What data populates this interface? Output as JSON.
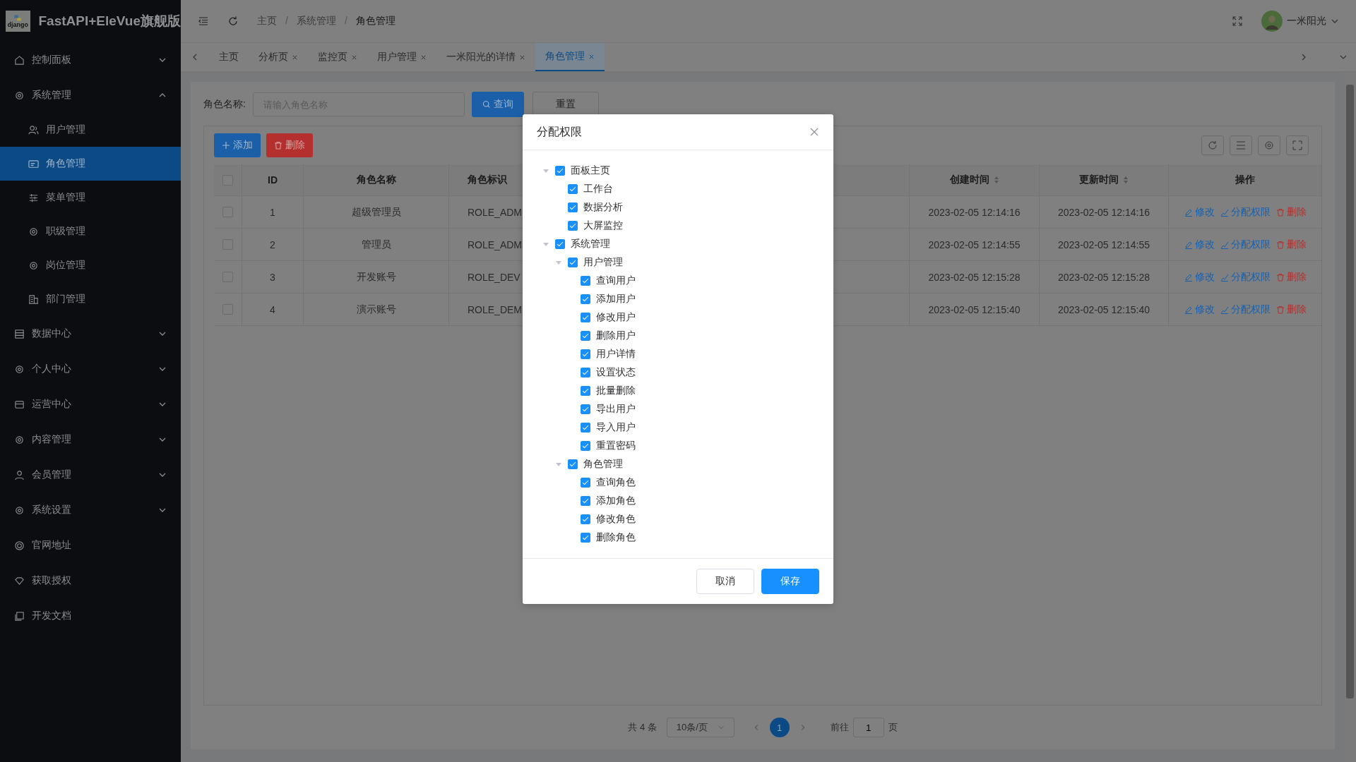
{
  "app": {
    "logo_text": "django",
    "title": "FastAPI+EleVue旗舰版"
  },
  "sidebar": {
    "items": [
      {
        "kind": "group",
        "label": "控制面板",
        "expanded": false,
        "selected": false
      },
      {
        "kind": "group",
        "label": "系统管理",
        "expanded": true,
        "selected": false,
        "children": [
          {
            "label": "用户管理",
            "selected": false
          },
          {
            "label": "角色管理",
            "selected": true
          },
          {
            "label": "菜单管理",
            "selected": false
          },
          {
            "label": "职级管理",
            "selected": false
          },
          {
            "label": "岗位管理",
            "selected": false
          },
          {
            "label": "部门管理",
            "selected": false
          }
        ]
      },
      {
        "kind": "group",
        "label": "数据中心",
        "expanded": false,
        "selected": false
      },
      {
        "kind": "group",
        "label": "个人中心",
        "expanded": false,
        "selected": false
      },
      {
        "kind": "group",
        "label": "运营中心",
        "expanded": false,
        "selected": false
      },
      {
        "kind": "group",
        "label": "内容管理",
        "expanded": false,
        "selected": false
      },
      {
        "kind": "group",
        "label": "会员管理",
        "expanded": false,
        "selected": false
      },
      {
        "kind": "group",
        "label": "系统设置",
        "expanded": false,
        "selected": false
      },
      {
        "kind": "link",
        "label": "官网地址",
        "selected": false
      },
      {
        "kind": "link",
        "label": "获取授权",
        "selected": false
      },
      {
        "kind": "link",
        "label": "开发文档",
        "selected": false
      }
    ]
  },
  "header": {
    "breadcrumb": [
      "主页",
      "系统管理",
      "角色管理"
    ],
    "breadcrumb_separator": "/",
    "user": "一米阳光"
  },
  "tabs": [
    {
      "label": "主页",
      "closable": false,
      "selected": false
    },
    {
      "label": "分析页",
      "closable": true,
      "selected": false
    },
    {
      "label": "监控页",
      "closable": true,
      "selected": false
    },
    {
      "label": "用户管理",
      "closable": true,
      "selected": false
    },
    {
      "label": "一米阳光的详情",
      "closable": true,
      "selected": false
    },
    {
      "label": "角色管理",
      "closable": true,
      "selected": true
    }
  ],
  "search": {
    "label": "角色名称:",
    "placeholder": "请输入角色名称",
    "query": "查询",
    "reset": "重置"
  },
  "toolbar": {
    "add": "添加",
    "delete": "删除"
  },
  "table": {
    "columns": [
      {
        "label": "ID",
        "sortable": false
      },
      {
        "label": "角色名称",
        "sortable": false
      },
      {
        "label": "角色标识",
        "sortable": false
      },
      {
        "label": "创建时间",
        "sortable": true
      },
      {
        "label": "更新时间",
        "sortable": true
      },
      {
        "label": "操作",
        "sortable": false
      }
    ],
    "all_checked": false,
    "rows": [
      {
        "checked": false,
        "id": "1",
        "name": "超级管理员",
        "code": "ROLE_ADM",
        "created": "2023-02-05 12:14:16",
        "updated": "2023-02-05 12:14:16",
        "actions": [
          "修改",
          "分配权限",
          "删除"
        ]
      },
      {
        "checked": false,
        "id": "2",
        "name": "管理员",
        "code": "ROLE_ADM",
        "created": "2023-02-05 12:14:55",
        "updated": "2023-02-05 12:14:55",
        "actions": [
          "修改",
          "分配权限",
          "删除"
        ]
      },
      {
        "checked": false,
        "id": "3",
        "name": "开发账号",
        "code": "ROLE_DEV",
        "created": "2023-02-05 12:15:28",
        "updated": "2023-02-05 12:15:28",
        "actions": [
          "修改",
          "分配权限",
          "删除"
        ]
      },
      {
        "checked": false,
        "id": "4",
        "name": "演示账号",
        "code": "ROLE_DEM",
        "created": "2023-02-05 12:15:40",
        "updated": "2023-02-05 12:15:40",
        "actions": [
          "修改",
          "分配权限",
          "删除"
        ]
      }
    ]
  },
  "pagination": {
    "total": "共 4 条",
    "size": "10条/页",
    "pages": [
      {
        "label": "1",
        "selected": true
      }
    ],
    "goto": "前往",
    "goto_value": "1",
    "page_unit": "页"
  },
  "dialog": {
    "title": "分配权限",
    "tree": [
      {
        "label": "面板主页",
        "checked": true,
        "expanded": true,
        "children": [
          {
            "label": "工作台",
            "checked": true
          },
          {
            "label": "数据分析",
            "checked": true
          },
          {
            "label": "大屏监控",
            "checked": true
          }
        ]
      },
      {
        "label": "系统管理",
        "checked": true,
        "expanded": true,
        "children": [
          {
            "label": "用户管理",
            "checked": true,
            "expanded": true,
            "children": [
              {
                "label": "查询用户",
                "checked": true
              },
              {
                "label": "添加用户",
                "checked": true
              },
              {
                "label": "修改用户",
                "checked": true
              },
              {
                "label": "删除用户",
                "checked": true
              },
              {
                "label": "用户详情",
                "checked": true
              },
              {
                "label": "设置状态",
                "checked": true
              },
              {
                "label": "批量删除",
                "checked": true
              },
              {
                "label": "导出用户",
                "checked": true
              },
              {
                "label": "导入用户",
                "checked": true
              },
              {
                "label": "重置密码",
                "checked": true
              }
            ]
          },
          {
            "label": "角色管理",
            "checked": true,
            "expanded": true,
            "children": [
              {
                "label": "查询角色",
                "checked": true
              },
              {
                "label": "添加角色",
                "checked": true
              },
              {
                "label": "修改角色",
                "checked": true
              },
              {
                "label": "删除角色",
                "checked": true
              }
            ]
          }
        ]
      }
    ],
    "cancel": "取消",
    "save": "保存"
  }
}
